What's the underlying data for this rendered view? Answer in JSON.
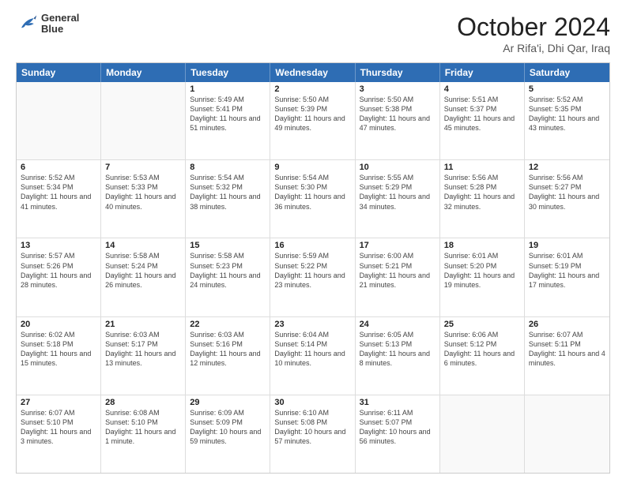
{
  "header": {
    "logo_line1": "General",
    "logo_line2": "Blue",
    "month_title": "October 2024",
    "location": "Ar Rifa'i, Dhi Qar, Iraq"
  },
  "calendar": {
    "days_of_week": [
      "Sunday",
      "Monday",
      "Tuesday",
      "Wednesday",
      "Thursday",
      "Friday",
      "Saturday"
    ],
    "rows": [
      [
        {
          "day": "",
          "text": ""
        },
        {
          "day": "",
          "text": ""
        },
        {
          "day": "1",
          "text": "Sunrise: 5:49 AM\nSunset: 5:41 PM\nDaylight: 11 hours and 51 minutes."
        },
        {
          "day": "2",
          "text": "Sunrise: 5:50 AM\nSunset: 5:39 PM\nDaylight: 11 hours and 49 minutes."
        },
        {
          "day": "3",
          "text": "Sunrise: 5:50 AM\nSunset: 5:38 PM\nDaylight: 11 hours and 47 minutes."
        },
        {
          "day": "4",
          "text": "Sunrise: 5:51 AM\nSunset: 5:37 PM\nDaylight: 11 hours and 45 minutes."
        },
        {
          "day": "5",
          "text": "Sunrise: 5:52 AM\nSunset: 5:35 PM\nDaylight: 11 hours and 43 minutes."
        }
      ],
      [
        {
          "day": "6",
          "text": "Sunrise: 5:52 AM\nSunset: 5:34 PM\nDaylight: 11 hours and 41 minutes."
        },
        {
          "day": "7",
          "text": "Sunrise: 5:53 AM\nSunset: 5:33 PM\nDaylight: 11 hours and 40 minutes."
        },
        {
          "day": "8",
          "text": "Sunrise: 5:54 AM\nSunset: 5:32 PM\nDaylight: 11 hours and 38 minutes."
        },
        {
          "day": "9",
          "text": "Sunrise: 5:54 AM\nSunset: 5:30 PM\nDaylight: 11 hours and 36 minutes."
        },
        {
          "day": "10",
          "text": "Sunrise: 5:55 AM\nSunset: 5:29 PM\nDaylight: 11 hours and 34 minutes."
        },
        {
          "day": "11",
          "text": "Sunrise: 5:56 AM\nSunset: 5:28 PM\nDaylight: 11 hours and 32 minutes."
        },
        {
          "day": "12",
          "text": "Sunrise: 5:56 AM\nSunset: 5:27 PM\nDaylight: 11 hours and 30 minutes."
        }
      ],
      [
        {
          "day": "13",
          "text": "Sunrise: 5:57 AM\nSunset: 5:26 PM\nDaylight: 11 hours and 28 minutes."
        },
        {
          "day": "14",
          "text": "Sunrise: 5:58 AM\nSunset: 5:24 PM\nDaylight: 11 hours and 26 minutes."
        },
        {
          "day": "15",
          "text": "Sunrise: 5:58 AM\nSunset: 5:23 PM\nDaylight: 11 hours and 24 minutes."
        },
        {
          "day": "16",
          "text": "Sunrise: 5:59 AM\nSunset: 5:22 PM\nDaylight: 11 hours and 23 minutes."
        },
        {
          "day": "17",
          "text": "Sunrise: 6:00 AM\nSunset: 5:21 PM\nDaylight: 11 hours and 21 minutes."
        },
        {
          "day": "18",
          "text": "Sunrise: 6:01 AM\nSunset: 5:20 PM\nDaylight: 11 hours and 19 minutes."
        },
        {
          "day": "19",
          "text": "Sunrise: 6:01 AM\nSunset: 5:19 PM\nDaylight: 11 hours and 17 minutes."
        }
      ],
      [
        {
          "day": "20",
          "text": "Sunrise: 6:02 AM\nSunset: 5:18 PM\nDaylight: 11 hours and 15 minutes."
        },
        {
          "day": "21",
          "text": "Sunrise: 6:03 AM\nSunset: 5:17 PM\nDaylight: 11 hours and 13 minutes."
        },
        {
          "day": "22",
          "text": "Sunrise: 6:03 AM\nSunset: 5:16 PM\nDaylight: 11 hours and 12 minutes."
        },
        {
          "day": "23",
          "text": "Sunrise: 6:04 AM\nSunset: 5:14 PM\nDaylight: 11 hours and 10 minutes."
        },
        {
          "day": "24",
          "text": "Sunrise: 6:05 AM\nSunset: 5:13 PM\nDaylight: 11 hours and 8 minutes."
        },
        {
          "day": "25",
          "text": "Sunrise: 6:06 AM\nSunset: 5:12 PM\nDaylight: 11 hours and 6 minutes."
        },
        {
          "day": "26",
          "text": "Sunrise: 6:07 AM\nSunset: 5:11 PM\nDaylight: 11 hours and 4 minutes."
        }
      ],
      [
        {
          "day": "27",
          "text": "Sunrise: 6:07 AM\nSunset: 5:10 PM\nDaylight: 11 hours and 3 minutes."
        },
        {
          "day": "28",
          "text": "Sunrise: 6:08 AM\nSunset: 5:10 PM\nDaylight: 11 hours and 1 minute."
        },
        {
          "day": "29",
          "text": "Sunrise: 6:09 AM\nSunset: 5:09 PM\nDaylight: 10 hours and 59 minutes."
        },
        {
          "day": "30",
          "text": "Sunrise: 6:10 AM\nSunset: 5:08 PM\nDaylight: 10 hours and 57 minutes."
        },
        {
          "day": "31",
          "text": "Sunrise: 6:11 AM\nSunset: 5:07 PM\nDaylight: 10 hours and 56 minutes."
        },
        {
          "day": "",
          "text": ""
        },
        {
          "day": "",
          "text": ""
        }
      ]
    ]
  }
}
